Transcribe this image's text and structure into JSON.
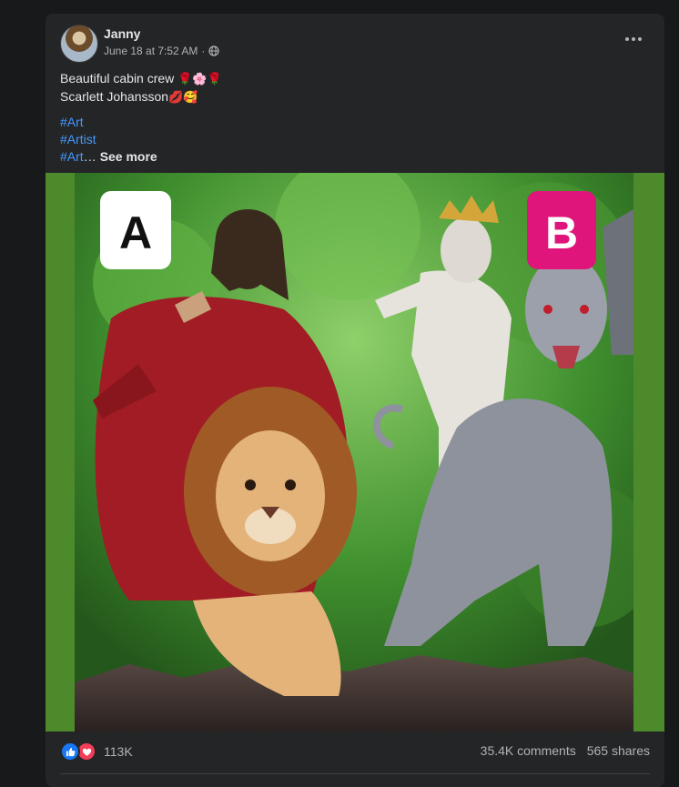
{
  "post": {
    "author": "Janny",
    "timestamp": "June 18 at 7:52 AM",
    "separator": "·",
    "privacy_icon": "globe-icon",
    "text_line1": "Beautiful cabin crew",
    "text_line1_emoji": "🌹🌸🌹",
    "text_line2": "Scarlett Johansson",
    "text_line2_emoji": "💋🥰",
    "hashtags": [
      "#Art",
      "#Artist",
      "#Art"
    ],
    "ellipsis": "…",
    "see_more": "See more"
  },
  "image": {
    "badge_a": "A",
    "badge_b": "B",
    "badge_b_color": "#e0157b",
    "background_color": "#4d8a2c"
  },
  "stats": {
    "reactions_count": "113K",
    "comments": "35.4K comments",
    "shares": "565 shares",
    "reaction_icons": [
      "like-icon",
      "love-icon"
    ]
  },
  "colors": {
    "page_bg": "#18191a",
    "card_bg": "#242526",
    "link": "#4599ff",
    "secondary_text": "#b0b3b8"
  }
}
